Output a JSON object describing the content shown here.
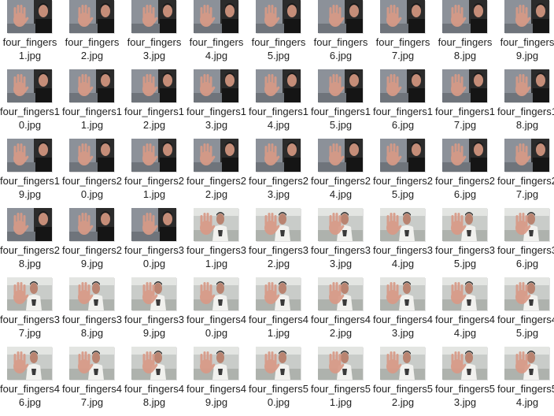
{
  "files": [
    {
      "name": "four_fingers1.jpg",
      "scene": "dark"
    },
    {
      "name": "four_fingers2.jpg",
      "scene": "dark"
    },
    {
      "name": "four_fingers3.jpg",
      "scene": "dark"
    },
    {
      "name": "four_fingers4.jpg",
      "scene": "dark"
    },
    {
      "name": "four_fingers5.jpg",
      "scene": "dark"
    },
    {
      "name": "four_fingers6.jpg",
      "scene": "dark"
    },
    {
      "name": "four_fingers7.jpg",
      "scene": "dark"
    },
    {
      "name": "four_fingers8.jpg",
      "scene": "dark"
    },
    {
      "name": "four_fingers9.jpg",
      "scene": "dark"
    },
    {
      "name": "four_fingers10.jpg",
      "scene": "dark"
    },
    {
      "name": "four_fingers11.jpg",
      "scene": "dark"
    },
    {
      "name": "four_fingers12.jpg",
      "scene": "dark"
    },
    {
      "name": "four_fingers13.jpg",
      "scene": "dark"
    },
    {
      "name": "four_fingers14.jpg",
      "scene": "dark"
    },
    {
      "name": "four_fingers15.jpg",
      "scene": "dark"
    },
    {
      "name": "four_fingers16.jpg",
      "scene": "dark"
    },
    {
      "name": "four_fingers17.jpg",
      "scene": "dark"
    },
    {
      "name": "four_fingers18.jpg",
      "scene": "dark"
    },
    {
      "name": "four_fingers19.jpg",
      "scene": "dark"
    },
    {
      "name": "four_fingers20.jpg",
      "scene": "dark"
    },
    {
      "name": "four_fingers21.jpg",
      "scene": "dark"
    },
    {
      "name": "four_fingers22.jpg",
      "scene": "dark"
    },
    {
      "name": "four_fingers23.jpg",
      "scene": "dark"
    },
    {
      "name": "four_fingers24.jpg",
      "scene": "dark"
    },
    {
      "name": "four_fingers25.jpg",
      "scene": "dark"
    },
    {
      "name": "four_fingers26.jpg",
      "scene": "dark"
    },
    {
      "name": "four_fingers27.jpg",
      "scene": "dark"
    },
    {
      "name": "four_fingers28.jpg",
      "scene": "dark"
    },
    {
      "name": "four_fingers29.jpg",
      "scene": "dark"
    },
    {
      "name": "four_fingers30.jpg",
      "scene": "dark"
    },
    {
      "name": "four_fingers31.jpg",
      "scene": "light"
    },
    {
      "name": "four_fingers32.jpg",
      "scene": "light"
    },
    {
      "name": "four_fingers33.jpg",
      "scene": "light"
    },
    {
      "name": "four_fingers34.jpg",
      "scene": "light"
    },
    {
      "name": "four_fingers35.jpg",
      "scene": "light"
    },
    {
      "name": "four_fingers36.jpg",
      "scene": "light"
    },
    {
      "name": "four_fingers37.jpg",
      "scene": "light"
    },
    {
      "name": "four_fingers38.jpg",
      "scene": "light"
    },
    {
      "name": "four_fingers39.jpg",
      "scene": "light"
    },
    {
      "name": "four_fingers40.jpg",
      "scene": "light"
    },
    {
      "name": "four_fingers41.jpg",
      "scene": "light"
    },
    {
      "name": "four_fingers42.jpg",
      "scene": "light"
    },
    {
      "name": "four_fingers43.jpg",
      "scene": "light"
    },
    {
      "name": "four_fingers44.jpg",
      "scene": "light"
    },
    {
      "name": "four_fingers45.jpg",
      "scene": "light"
    },
    {
      "name": "four_fingers46.jpg",
      "scene": "light"
    },
    {
      "name": "four_fingers47.jpg",
      "scene": "light"
    },
    {
      "name": "four_fingers48.jpg",
      "scene": "light"
    },
    {
      "name": "four_fingers49.jpg",
      "scene": "light"
    },
    {
      "name": "four_fingers50.jpg",
      "scene": "light"
    },
    {
      "name": "four_fingers51.jpg",
      "scene": "light"
    },
    {
      "name": "four_fingers52.jpg",
      "scene": "light"
    },
    {
      "name": "four_fingers53.jpg",
      "scene": "light"
    },
    {
      "name": "four_fingers54.jpg",
      "scene": "light"
    }
  ],
  "colors": {
    "text": "#1f1f1f",
    "background": "#ffffff",
    "dark_wall": "#8c9199",
    "dark_bg": "#2b2b2b",
    "light_wall": "#c9ccc9",
    "skin": "#d99a86"
  }
}
